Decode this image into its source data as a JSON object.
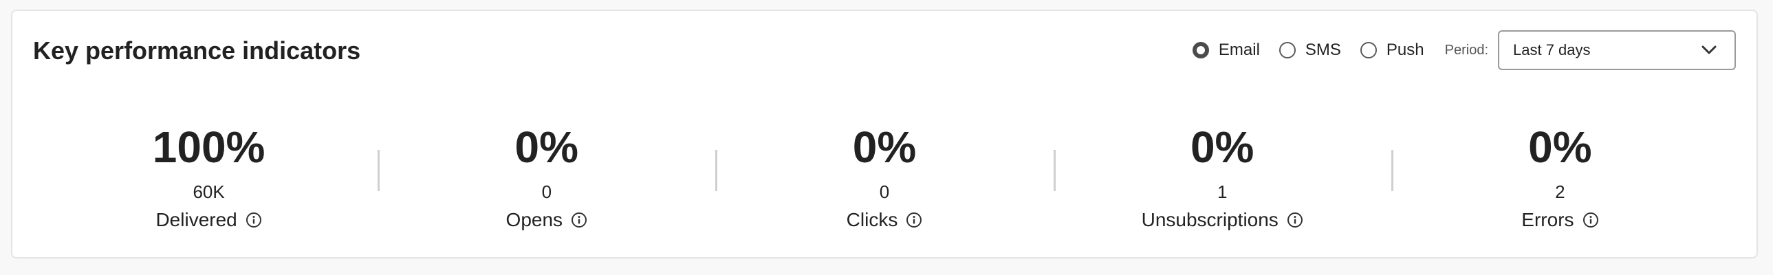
{
  "card": {
    "title": "Key performance indicators"
  },
  "controls": {
    "channels": [
      {
        "label": "Email",
        "checked": true
      },
      {
        "label": "SMS",
        "checked": false
      },
      {
        "label": "Push",
        "checked": false
      }
    ],
    "period_label": "Period:",
    "period_value": "Last 7 days",
    "dropdown_icon": "chevron-down-icon"
  },
  "kpis": [
    {
      "percent": "100%",
      "count": "60K",
      "label": "Delivered",
      "icon": "info-icon"
    },
    {
      "percent": "0%",
      "count": "0",
      "label": "Opens",
      "icon": "info-icon"
    },
    {
      "percent": "0%",
      "count": "0",
      "label": "Clicks",
      "icon": "info-icon"
    },
    {
      "percent": "0%",
      "count": "1",
      "label": "Unsubscriptions",
      "icon": "info-icon"
    },
    {
      "percent": "0%",
      "count": "2",
      "label": "Errors",
      "icon": "info-icon"
    }
  ],
  "colors": {
    "background": "#f8f8f8",
    "card": "#ffffff",
    "text": "#222222",
    "divider": "#cfcfcf"
  }
}
